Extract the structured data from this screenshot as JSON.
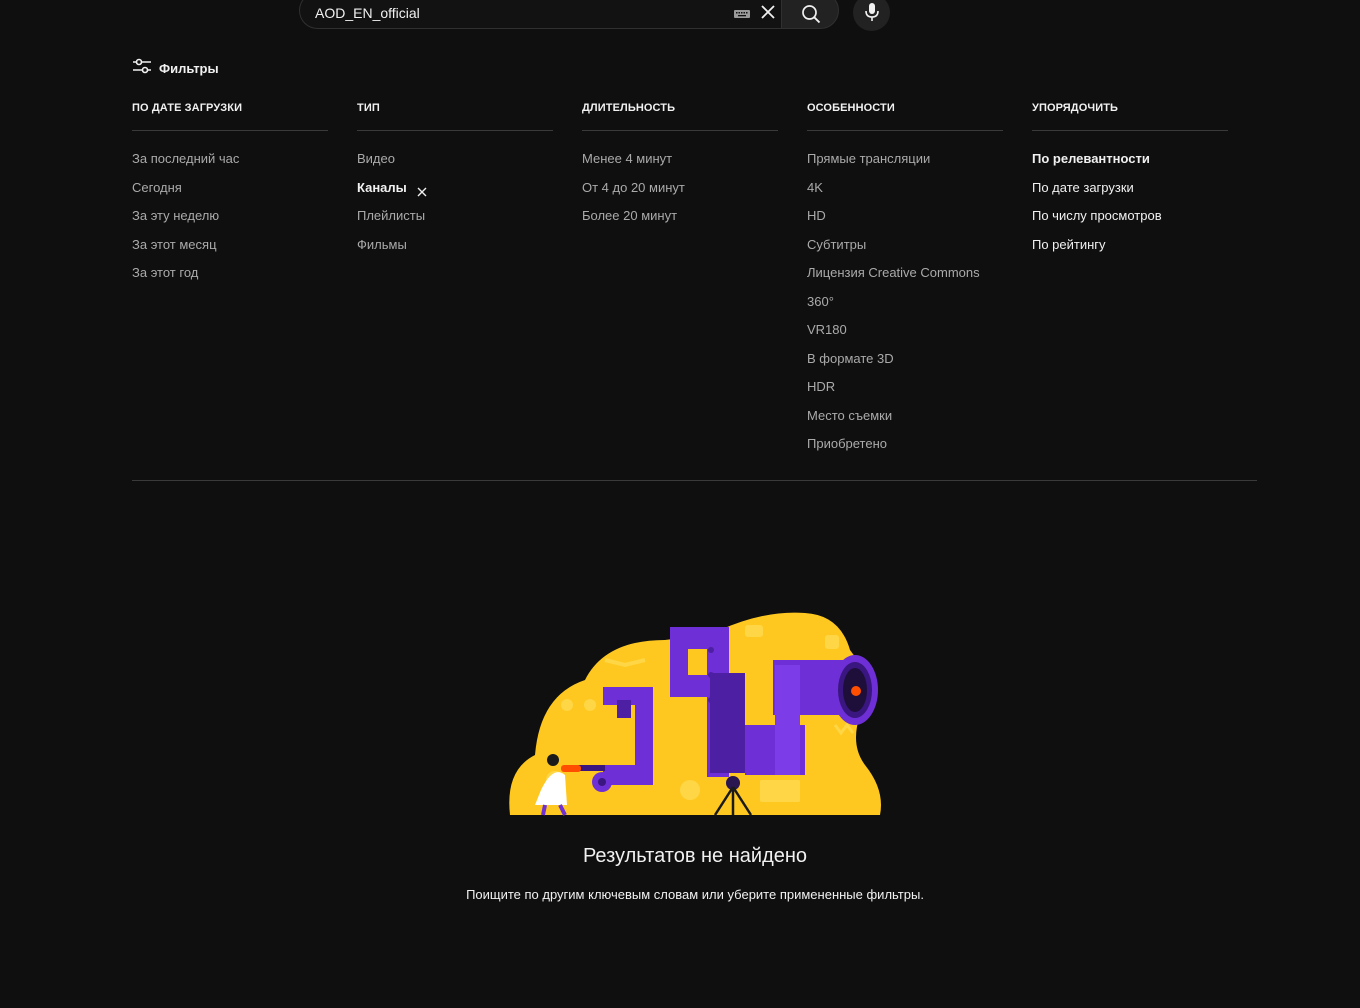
{
  "search": {
    "query": "AOD_EN_official"
  },
  "filters": {
    "toggle_label": "Фильтры",
    "columns": [
      {
        "title": "По дате загрузки",
        "items": [
          "За последний час",
          "Сегодня",
          "За эту неделю",
          "За этот месяц",
          "За этот год"
        ]
      },
      {
        "title": "Тип",
        "items": [
          "Видео",
          "Каналы",
          "Плейлисты",
          "Фильмы"
        ],
        "active": "Каналы"
      },
      {
        "title": "Длительность",
        "items": [
          "Менее 4 минут",
          "От 4 до 20 минут",
          "Более 20 минут"
        ]
      },
      {
        "title": "Особенности",
        "items": [
          "Прямые трансляции",
          "4K",
          "HD",
          "Субтитры",
          "Лицензия Creative Commons",
          "360°",
          "VR180",
          "В формате 3D",
          "HDR",
          "Место съемки",
          "Приобретено"
        ]
      },
      {
        "title": "Упорядочить",
        "items": [
          "По релевантности",
          "По дате загрузки",
          "По числу просмотров",
          "По рейтингу"
        ],
        "active": "По релевантности"
      }
    ]
  },
  "empty_state": {
    "title": "Результатов не найдено",
    "subtitle": "Поищите по другим ключевым словам или уберите примененные фильтры."
  },
  "colors": {
    "background": "#0f0f0f",
    "illustration_yellow": "#ffc820",
    "illustration_purple": "#6f2fd6",
    "illustration_accent": "#ff4e00"
  }
}
